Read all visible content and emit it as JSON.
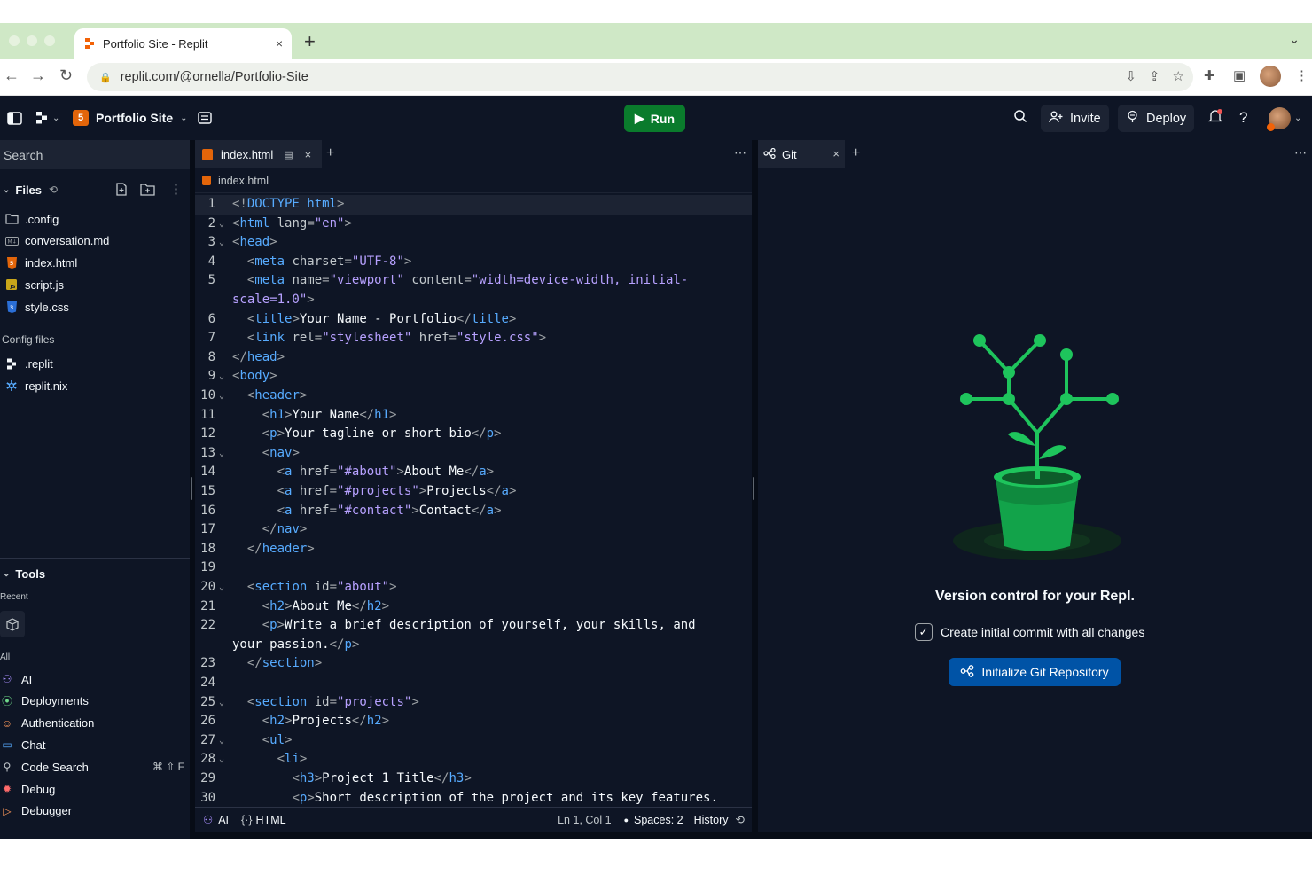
{
  "browser": {
    "tab_title": "Portfolio Site - Replit",
    "new_tab": "+",
    "close": "×",
    "url": "replit.com/@ornella/Portfolio-Site"
  },
  "topbar": {
    "project_name": "Portfolio Site",
    "run_label": "Run",
    "invite_label": "Invite",
    "deploy_label": "Deploy",
    "help": "?"
  },
  "sidebar": {
    "search_placeholder": "Search",
    "files_label": "Files",
    "files": [
      {
        "name": ".config",
        "icon": "folder-icon"
      },
      {
        "name": "conversation.md",
        "icon": "markdown-icon"
      },
      {
        "name": "index.html",
        "icon": "html-icon"
      },
      {
        "name": "script.js",
        "icon": "js-icon"
      },
      {
        "name": "style.css",
        "icon": "css-icon"
      }
    ],
    "config_label": "Config files",
    "config_files": [
      {
        "name": ".replit",
        "icon": "replit-icon"
      },
      {
        "name": "replit.nix",
        "icon": "nix-icon"
      }
    ],
    "tools_label": "Tools",
    "recent_label": "Recent",
    "all_label": "All",
    "tools": [
      {
        "name": "AI",
        "icon": "ai-icon",
        "color": "#a98fff"
      },
      {
        "name": "Deployments",
        "icon": "deploy-icon",
        "color": "#6fd98a"
      },
      {
        "name": "Authentication",
        "icon": "user-icon",
        "color": "#ff9a5c"
      },
      {
        "name": "Chat",
        "icon": "chat-icon",
        "color": "#57abff"
      },
      {
        "name": "Code Search",
        "icon": "search-icon",
        "color": "#c2c8cc",
        "shortcut": "⌘ ⇧ F"
      },
      {
        "name": "Debug",
        "icon": "bug-icon",
        "color": "#ff6b6b"
      },
      {
        "name": "Debugger",
        "icon": "debugger-icon",
        "color": "#ff9a5c"
      }
    ]
  },
  "editor": {
    "tab_label": "index.html",
    "breadcrumb": "index.html",
    "lines": [
      {
        "n": "1",
        "fold": false,
        "html": "<span class='p'>&lt;!</span><span class='k'>DOCTYPE html</span><span class='p'>&gt;</span>"
      },
      {
        "n": "2",
        "fold": true,
        "html": "<span class='p'>&lt;</span><span class='k'>html</span> <span class='a'>lang</span><span class='p'>=</span><span class='s'>\"en\"</span><span class='p'>&gt;</span>"
      },
      {
        "n": "3",
        "fold": true,
        "html": "<span class='p'>&lt;</span><span class='k'>head</span><span class='p'>&gt;</span>"
      },
      {
        "n": "4",
        "fold": false,
        "html": "  <span class='p'>&lt;</span><span class='k'>meta</span> <span class='a'>charset</span><span class='p'>=</span><span class='s'>\"UTF-8\"</span><span class='p'>&gt;</span>"
      },
      {
        "n": "5",
        "fold": false,
        "html": "  <span class='p'>&lt;</span><span class='k'>meta</span> <span class='a'>name</span><span class='p'>=</span><span class='s'>\"viewport\"</span> <span class='a'>content</span><span class='p'>=</span><span class='s'>\"width=device-width, initial-</span>"
      },
      {
        "n": "",
        "fold": false,
        "html": "<span class='s'>scale=1.0\"</span><span class='p'>&gt;</span>"
      },
      {
        "n": "6",
        "fold": false,
        "html": "  <span class='p'>&lt;</span><span class='k'>title</span><span class='p'>&gt;</span>Your Name - Portfolio<span class='p'>&lt;/</span><span class='k'>title</span><span class='p'>&gt;</span>"
      },
      {
        "n": "7",
        "fold": false,
        "html": "  <span class='p'>&lt;</span><span class='k'>link</span> <span class='a'>rel</span><span class='p'>=</span><span class='s'>\"stylesheet\"</span> <span class='a'>href</span><span class='p'>=</span><span class='s'>\"style.css\"</span><span class='p'>&gt;</span>"
      },
      {
        "n": "8",
        "fold": false,
        "html": "<span class='p'>&lt;/</span><span class='k'>head</span><span class='p'>&gt;</span>"
      },
      {
        "n": "9",
        "fold": true,
        "html": "<span class='p'>&lt;</span><span class='k'>body</span><span class='p'>&gt;</span>"
      },
      {
        "n": "10",
        "fold": true,
        "html": "  <span class='p'>&lt;</span><span class='k'>header</span><span class='p'>&gt;</span>"
      },
      {
        "n": "11",
        "fold": false,
        "html": "    <span class='p'>&lt;</span><span class='k'>h1</span><span class='p'>&gt;</span>Your Name<span class='p'>&lt;/</span><span class='k'>h1</span><span class='p'>&gt;</span>"
      },
      {
        "n": "12",
        "fold": false,
        "html": "    <span class='p'>&lt;</span><span class='k'>p</span><span class='p'>&gt;</span>Your tagline or short bio<span class='p'>&lt;/</span><span class='k'>p</span><span class='p'>&gt;</span>"
      },
      {
        "n": "13",
        "fold": true,
        "html": "    <span class='p'>&lt;</span><span class='k'>nav</span><span class='p'>&gt;</span>"
      },
      {
        "n": "14",
        "fold": false,
        "html": "      <span class='p'>&lt;</span><span class='k'>a</span> <span class='a'>href</span><span class='p'>=</span><span class='s'>\"#about\"</span><span class='p'>&gt;</span>About Me<span class='p'>&lt;/</span><span class='k'>a</span><span class='p'>&gt;</span>"
      },
      {
        "n": "15",
        "fold": false,
        "html": "      <span class='p'>&lt;</span><span class='k'>a</span> <span class='a'>href</span><span class='p'>=</span><span class='s'>\"#projects\"</span><span class='p'>&gt;</span>Projects<span class='p'>&lt;/</span><span class='k'>a</span><span class='p'>&gt;</span>"
      },
      {
        "n": "16",
        "fold": false,
        "html": "      <span class='p'>&lt;</span><span class='k'>a</span> <span class='a'>href</span><span class='p'>=</span><span class='s'>\"#contact\"</span><span class='p'>&gt;</span>Contact<span class='p'>&lt;/</span><span class='k'>a</span><span class='p'>&gt;</span>"
      },
      {
        "n": "17",
        "fold": false,
        "html": "    <span class='p'>&lt;/</span><span class='k'>nav</span><span class='p'>&gt;</span>"
      },
      {
        "n": "18",
        "fold": false,
        "html": "  <span class='p'>&lt;/</span><span class='k'>header</span><span class='p'>&gt;</span>"
      },
      {
        "n": "19",
        "fold": false,
        "html": ""
      },
      {
        "n": "20",
        "fold": true,
        "html": "  <span class='p'>&lt;</span><span class='k'>section</span> <span class='a'>id</span><span class='p'>=</span><span class='s'>\"about\"</span><span class='p'>&gt;</span>"
      },
      {
        "n": "21",
        "fold": false,
        "html": "    <span class='p'>&lt;</span><span class='k'>h2</span><span class='p'>&gt;</span>About Me<span class='p'>&lt;/</span><span class='k'>h2</span><span class='p'>&gt;</span>"
      },
      {
        "n": "22",
        "fold": false,
        "html": "    <span class='p'>&lt;</span><span class='k'>p</span><span class='p'>&gt;</span>Write a brief description of yourself, your skills, and"
      },
      {
        "n": "",
        "fold": false,
        "html": "your passion.<span class='p'>&lt;/</span><span class='k'>p</span><span class='p'>&gt;</span>"
      },
      {
        "n": "23",
        "fold": false,
        "html": "  <span class='p'>&lt;/</span><span class='k'>section</span><span class='p'>&gt;</span>"
      },
      {
        "n": "24",
        "fold": false,
        "html": ""
      },
      {
        "n": "25",
        "fold": true,
        "html": "  <span class='p'>&lt;</span><span class='k'>section</span> <span class='a'>id</span><span class='p'>=</span><span class='s'>\"projects\"</span><span class='p'>&gt;</span>"
      },
      {
        "n": "26",
        "fold": false,
        "html": "    <span class='p'>&lt;</span><span class='k'>h2</span><span class='p'>&gt;</span>Projects<span class='p'>&lt;/</span><span class='k'>h2</span><span class='p'>&gt;</span>"
      },
      {
        "n": "27",
        "fold": true,
        "html": "    <span class='p'>&lt;</span><span class='k'>ul</span><span class='p'>&gt;</span>"
      },
      {
        "n": "28",
        "fold": true,
        "html": "      <span class='p'>&lt;</span><span class='k'>li</span><span class='p'>&gt;</span>"
      },
      {
        "n": "29",
        "fold": false,
        "html": "        <span class='p'>&lt;</span><span class='k'>h3</span><span class='p'>&gt;</span>Project 1 Title<span class='p'>&lt;/</span><span class='k'>h3</span><span class='p'>&gt;</span>"
      },
      {
        "n": "30",
        "fold": false,
        "html": "        <span class='p'>&lt;</span><span class='k'>p</span><span class='p'>&gt;</span>Short description of the project and its key features."
      }
    ],
    "status": {
      "ai": "AI",
      "lang": "HTML",
      "position": "Ln 1, Col 1",
      "spaces": "Spaces: 2",
      "history": "History"
    }
  },
  "git": {
    "tab_label": "Git",
    "title": "Version control for your Repl.",
    "checkbox_label": "Create initial commit with all changes",
    "checkbox_checked": true,
    "button_label": "Initialize Git Repository"
  },
  "colors": {
    "keyword": "#57abff",
    "attr": "#c2c8cc",
    "string": "#b7a1ff",
    "punct": "#9da2a6",
    "run_green": "#0a7b2c",
    "git_button": "#0053a6",
    "plant_green": "#1ec45c"
  }
}
